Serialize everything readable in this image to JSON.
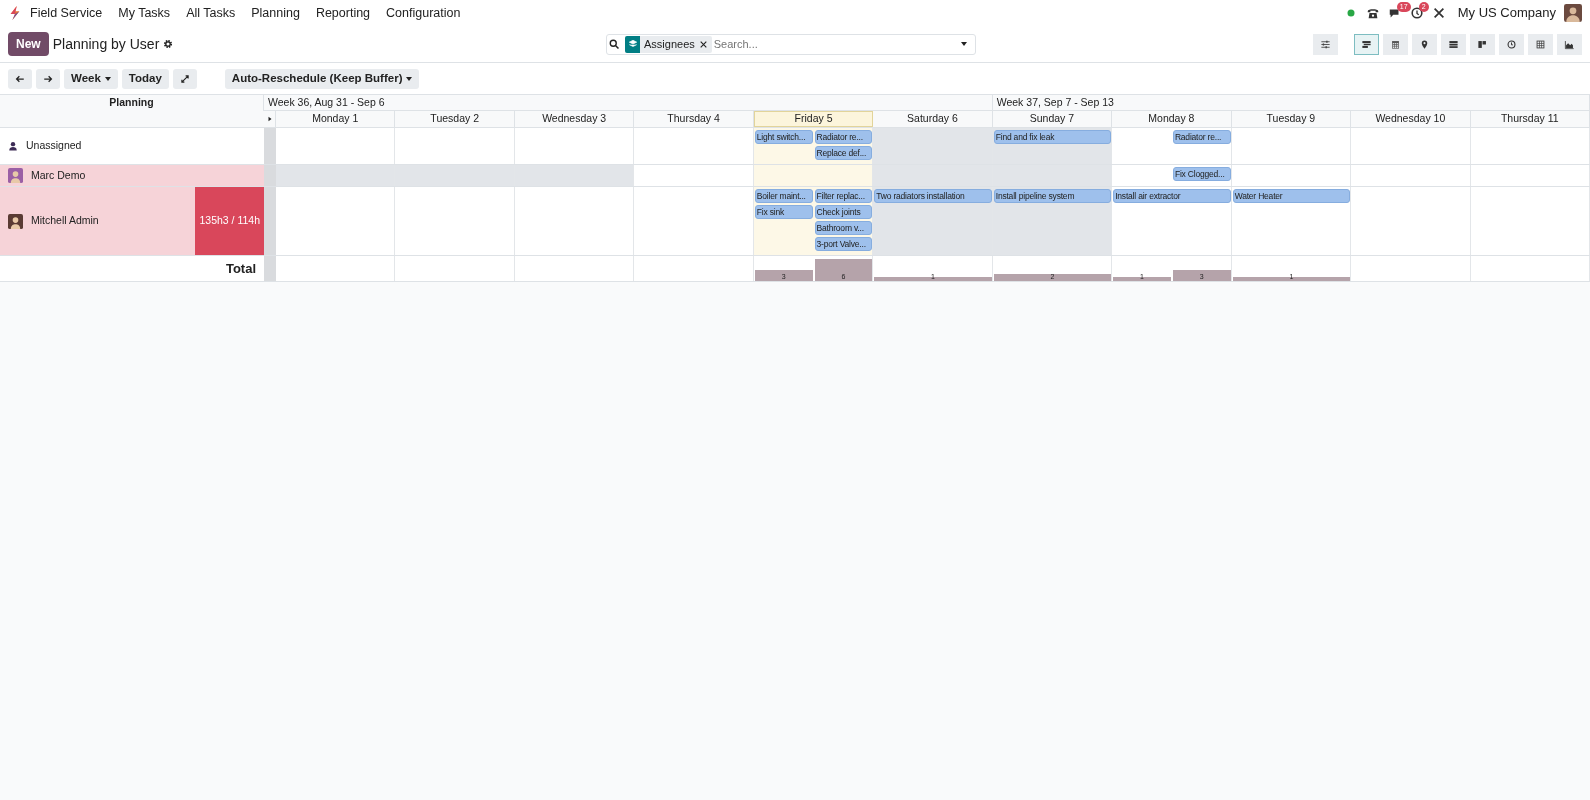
{
  "navbar": {
    "app_name": "Field Service",
    "menu": [
      "My Tasks",
      "All Tasks",
      "Planning",
      "Reporting",
      "Configuration"
    ],
    "systray": [
      {
        "kind": "status"
      },
      {
        "kind": "phone"
      },
      {
        "kind": "messages",
        "badge": "17"
      },
      {
        "kind": "activities",
        "badge": "2"
      },
      {
        "kind": "tools"
      }
    ],
    "company": "My US Company"
  },
  "control_panel": {
    "new_button": "New",
    "title": "Planning by User",
    "search": {
      "facet": "Assignees",
      "placeholder": "Search..."
    },
    "views": [
      {
        "kind": "gantt",
        "selected": true
      },
      {
        "kind": "calendar",
        "selected": false
      },
      {
        "kind": "map",
        "selected": false
      },
      {
        "kind": "list",
        "selected": false
      },
      {
        "kind": "kanban",
        "selected": false
      },
      {
        "kind": "activity",
        "selected": false
      },
      {
        "kind": "pivot",
        "selected": false
      },
      {
        "kind": "graph",
        "selected": false
      }
    ]
  },
  "toolbar": {
    "scale": "Week",
    "today": "Today",
    "reschedule": "Auto-Reschedule (Keep Buffer)"
  },
  "gantt": {
    "header": "Planning",
    "weeks": [
      {
        "label": "Week 36, Aug 31 - Sep 6",
        "days": [
          {
            "label": "Monday 1",
            "today": false
          },
          {
            "label": "Tuesday 2",
            "today": false
          },
          {
            "label": "Wednesday 3",
            "today": false
          },
          {
            "label": "Thursday 4",
            "today": false
          },
          {
            "label": "Friday 5",
            "today": true,
            "total_bars": [
              {
                "label": "3",
                "morning": true,
                "afternoon": false
              },
              {
                "label": "6",
                "morning": false,
                "afternoon": true
              }
            ]
          },
          {
            "label": "Saturday 6",
            "today": false,
            "total_bars": [
              {
                "label": "1",
                "morning": true,
                "afternoon": true
              }
            ]
          }
        ]
      },
      {
        "label": "Week 37, Sep 7 - Sep 13",
        "days": [
          {
            "label": "Sunday 7",
            "today": false,
            "total_bars": [
              {
                "label": "2",
                "morning": true,
                "afternoon": true
              }
            ]
          },
          {
            "label": "Monday 8",
            "today": false,
            "total_bars": [
              {
                "label": "1",
                "morning": true,
                "afternoon": false
              },
              {
                "label": "3",
                "morning": false,
                "afternoon": true
              }
            ]
          },
          {
            "label": "Tuesday 9",
            "today": false,
            "total_bars": [
              {
                "label": "1",
                "morning": true,
                "afternoon": true
              }
            ]
          },
          {
            "label": "Wednesday 10",
            "today": false
          },
          {
            "label": "Thursday 11",
            "today": false
          }
        ]
      }
    ],
    "rows": [
      {
        "name": "Unassigned",
        "kind": "unassigned",
        "highlighted": false,
        "days": [
          {
            "unavailable": false
          },
          {
            "unavailable": false
          },
          {
            "unavailable": false
          },
          {
            "unavailable": false
          },
          {
            "unavailable": false,
            "tasks": [
              {
                "text": "Light switch...",
                "morning": true,
                "afternoon": false
              },
              {
                "text": "Radiator re...",
                "morning": false,
                "afternoon": true
              },
              {
                "text": "Replace def...",
                "morning": false,
                "afternoon": true
              }
            ]
          },
          {
            "unavailable": true
          },
          {
            "unavailable": true,
            "tasks": [
              {
                "text": "Find and fix leak",
                "morning": true,
                "afternoon": true
              }
            ]
          },
          {
            "unavailable": false,
            "tasks": [
              {
                "text": "Radiator re...",
                "morning": false,
                "afternoon": true
              }
            ]
          },
          {
            "unavailable": false
          },
          {
            "unavailable": false
          },
          {
            "unavailable": false
          }
        ]
      },
      {
        "name": "Marc Demo",
        "kind": "user",
        "color": "#9b5fa5",
        "highlighted": true,
        "days": [
          {
            "unavailable": true
          },
          {
            "unavailable": true
          },
          {
            "unavailable": true
          },
          {
            "unavailable": false
          },
          {
            "unavailable": false
          },
          {
            "unavailable": true
          },
          {
            "unavailable": true
          },
          {
            "unavailable": false,
            "tasks": [
              {
                "text": "Fix Clogged...",
                "morning": false,
                "afternoon": true
              }
            ]
          },
          {
            "unavailable": false
          },
          {
            "unavailable": false
          },
          {
            "unavailable": false
          }
        ]
      },
      {
        "name": "Mitchell Admin",
        "kind": "user",
        "color": "#5a3b34",
        "highlighted": true,
        "capacity": "135h3 / 114h",
        "days": [
          {
            "unavailable": false
          },
          {
            "unavailable": false
          },
          {
            "unavailable": false
          },
          {
            "unavailable": false
          },
          {
            "unavailable": false,
            "tasks": [
              {
                "text": "Boiler maint...",
                "morning": true,
                "afternoon": false
              },
              {
                "text": "Filter replac...",
                "morning": false,
                "afternoon": true
              },
              {
                "text": "Fix sink",
                "morning": true,
                "afternoon": false
              },
              {
                "text": "Check joints",
                "morning": false,
                "afternoon": true
              },
              {
                "text": "Bathroom v...",
                "morning": false,
                "afternoon": true
              },
              {
                "text": "3-port Valve...",
                "morning": false,
                "afternoon": true
              }
            ]
          },
          {
            "unavailable": true,
            "tasks": [
              {
                "text": "Two radiators installation",
                "morning": true,
                "afternoon": true
              }
            ]
          },
          {
            "unavailable": true,
            "tasks": [
              {
                "text": "Install pipeline system",
                "morning": true,
                "afternoon": true
              }
            ]
          },
          {
            "unavailable": false,
            "tasks": [
              {
                "text": "Install air extractor",
                "morning": true,
                "afternoon": true
              }
            ]
          },
          {
            "unavailable": false,
            "tasks": [
              {
                "text": "Water Heater",
                "morning": true,
                "afternoon": true
              }
            ]
          },
          {
            "unavailable": false
          },
          {
            "unavailable": false
          }
        ]
      }
    ],
    "total": {
      "label": "Total"
    }
  }
}
